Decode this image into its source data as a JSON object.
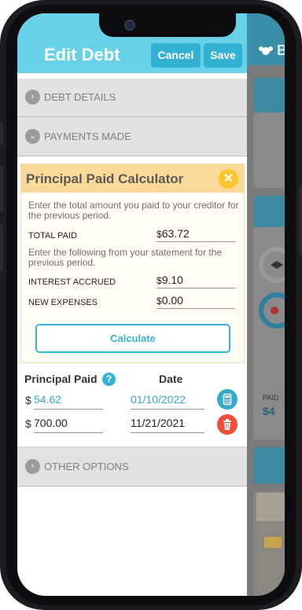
{
  "header": {
    "title": "Edit Debt",
    "cancel_label": "Cancel",
    "save_label": "Save"
  },
  "sections": {
    "debt_details": "DEBT DETAILS",
    "payments_made": "PAYMENTS MADE",
    "other_options": "OTHER OPTIONS"
  },
  "calculator": {
    "title": "Principal Paid Calculator",
    "instruction_1": "Enter the total amount you paid to your creditor for the previous period.",
    "total_paid_label": "TOTAL PAID",
    "total_paid_value": "63.72",
    "instruction_2": "Enter the following from your statement for the previous period.",
    "interest_label": "INTEREST ACCRUED",
    "interest_value": "9.10",
    "expenses_label": "NEW EXPENSES",
    "expenses_value": "0.00",
    "currency": "$",
    "calculate_label": "Calculate"
  },
  "payments": {
    "principal_header": "Principal Paid",
    "date_header": "Date",
    "help_symbol": "?",
    "currency": "$",
    "rows": [
      {
        "amount": "54.62",
        "date": "01/10/2022",
        "amount_color": "#36a8cf",
        "action": "calculator-icon"
      },
      {
        "amount": "700.00",
        "date": "11/21/2021",
        "amount_color": "#222222",
        "action": "trash-icon"
      }
    ]
  },
  "background_app": {
    "paid_label": "PAID",
    "amount_fragment": "$4"
  },
  "colors": {
    "header": "#67d1e8",
    "button": "#33b1d4",
    "calc_header": "#fbd996",
    "close": "#ffc52b",
    "delete": "#f04e3a"
  }
}
